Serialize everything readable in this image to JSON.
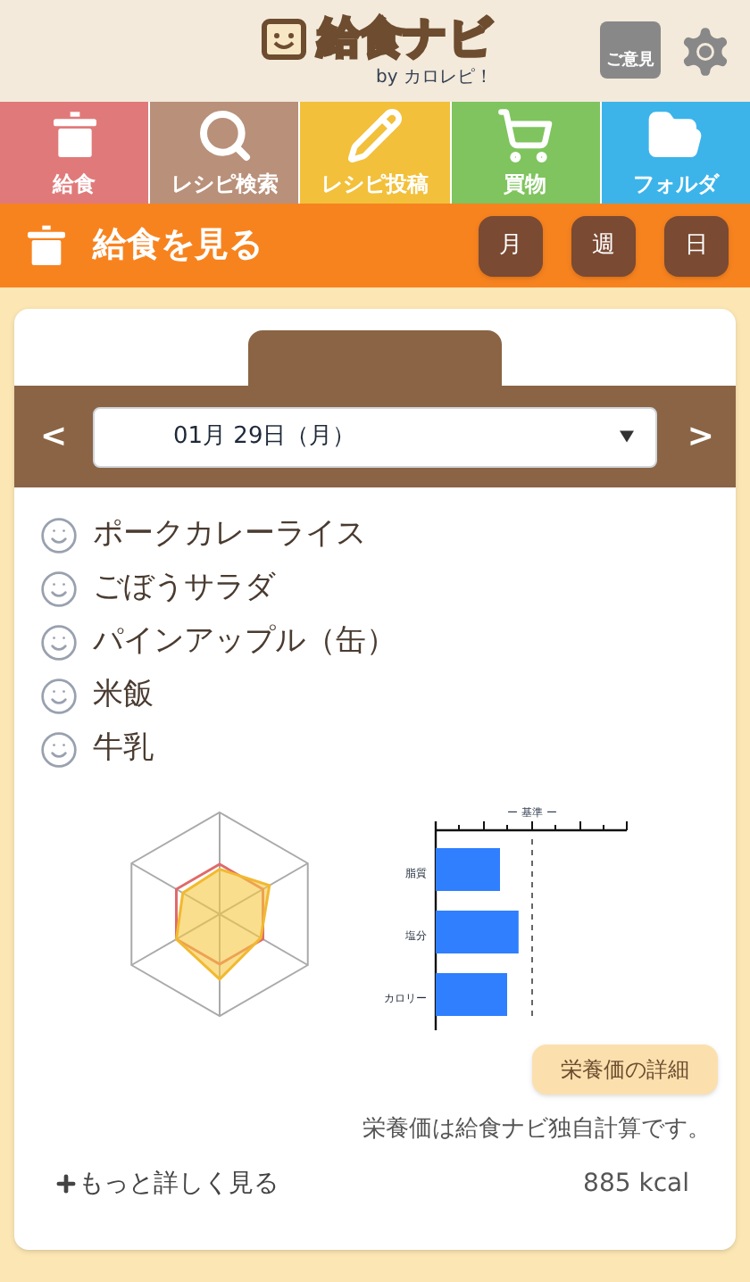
{
  "header": {
    "logo_text": "給食ナビ",
    "byline": "by カロレピ！",
    "feedback_label": "ご意見"
  },
  "nav": [
    {
      "label": "給食",
      "kind": "pot",
      "color": "#e07a7a"
    },
    {
      "label": "レシピ検索",
      "kind": "search",
      "color": "#b9907a"
    },
    {
      "label": "レシピ投稿",
      "kind": "pencil",
      "color": "#f2c03a"
    },
    {
      "label": "買物",
      "kind": "cart",
      "color": "#7fc45e"
    },
    {
      "label": "フォルダ",
      "kind": "folder",
      "color": "#3cb4ea"
    }
  ],
  "section": {
    "title": "給食を見る",
    "views": [
      "月",
      "週",
      "日"
    ]
  },
  "date_select": {
    "prev": "<",
    "value": "01月 29日（月）",
    "next": ">"
  },
  "menu": [
    "ポークカレーライス",
    "ごぼうサラダ",
    "パインアップル（缶）",
    "米飯",
    "牛乳"
  ],
  "bar_chart": {
    "title": "ー 基準 ー",
    "labels": [
      "脂質",
      "塩分",
      "カロリー"
    ]
  },
  "details_button": "栄養価の詳細",
  "note": "栄養価は給食ナビ独自計算です。",
  "more_link": "もっと詳しく見る",
  "calories": "885 kcal"
}
